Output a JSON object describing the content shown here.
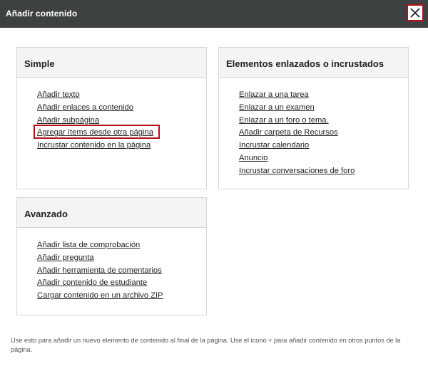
{
  "dialog": {
    "title": "Añadir contenido",
    "close_icon": "close-icon"
  },
  "simple": {
    "heading": "Simple",
    "items": [
      {
        "label": "Añadir texto"
      },
      {
        "label": "Añadir enlaces a contenido"
      },
      {
        "label": "Añadir subpágina"
      },
      {
        "label": "Agregar ítems desde otra página",
        "highlighted": true
      },
      {
        "label": "Incrustar contenido en la página"
      }
    ]
  },
  "linked": {
    "heading": "Elementos enlazados o incrustados",
    "items": [
      {
        "label": "Enlazar a una tarea"
      },
      {
        "label": "Enlazar a un examen"
      },
      {
        "label": "Enlazar a un foro o tema."
      },
      {
        "label": "Añadir carpeta de Recursos"
      },
      {
        "label": "Incrustar calendario"
      },
      {
        "label": "Anuncio"
      },
      {
        "label": "Incrustar conversaciones de foro"
      }
    ]
  },
  "advanced": {
    "heading": "Avanzado",
    "items": [
      {
        "label": "Añadir lista de comprobación"
      },
      {
        "label": "Añadir pregunta"
      },
      {
        "label": "Añadir herramienta de comentarios"
      },
      {
        "label": "Añadir contenido de estudiante"
      },
      {
        "label": "Cargar contenido en un archivo ZIP"
      }
    ]
  },
  "footer": {
    "text": "Use esto para añadir un nuevo elemento de contenido al final de la página. Use el icono + para añadir contenido en otros puntos de la página."
  },
  "colors": {
    "titlebar_bg": "#3d4142",
    "highlight_border": "#b3121b",
    "card_header_bg": "#f4f4f4",
    "card_border": "#d6d6d6"
  }
}
